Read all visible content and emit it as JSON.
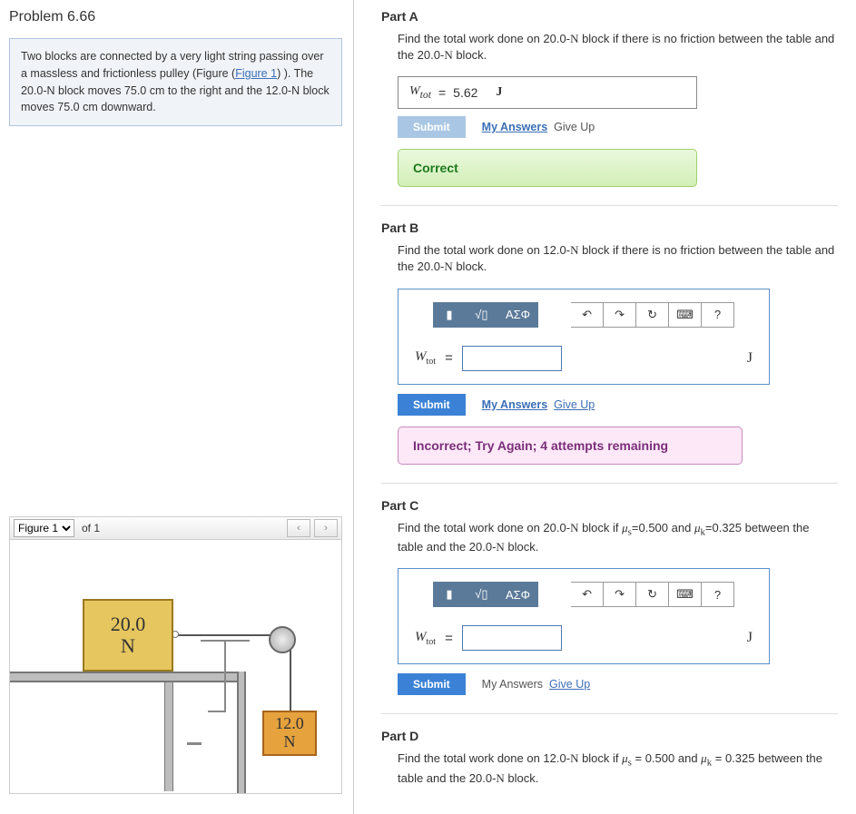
{
  "problem": {
    "title": "Problem 6.66",
    "description_pre": "Two blocks are connected by a very light string passing over a massless and frictionless pulley (Figure (",
    "figure_link": "Figure 1",
    "description_post": ") ). The 20.0-N block moves 75.0 cm to the right and the 12.0-N block moves 75.0 cm downward.",
    "block1_value": "20.0",
    "block1_unit": "N",
    "block2_value": "12.0",
    "block2_unit": "N"
  },
  "figure_bar": {
    "selected": "Figure 1",
    "of_label": "of 1",
    "prev": "‹",
    "next": "›"
  },
  "labels": {
    "submit": "Submit",
    "my_answers": "My Answers",
    "give_up": "Give Up",
    "w_var": "W",
    "w_sub": "tot",
    "equals": "=",
    "unit_J": "J"
  },
  "toolbar": {
    "tmpl": "▮",
    "frac": "√▯",
    "greek": "ΑΣΦ",
    "undo": "↶",
    "redo": "↷",
    "reset": "↻",
    "keyboard": "⌨",
    "help": "?"
  },
  "partA": {
    "label": "Part A",
    "prompt_1": "Find the total work done on 20.0-",
    "prompt_bold": "N",
    "prompt_2": " block if there is no friction between the table and the 20.0-",
    "prompt_bold2": "N",
    "prompt_3": " block.",
    "value": "5.62",
    "feedback": "Correct"
  },
  "partB": {
    "label": "Part B",
    "prompt_1": "Find the total work done on 12.0-",
    "prompt_bold": "N",
    "prompt_2": " block if there is no friction between the table and the 20.0-",
    "prompt_bold2": "N",
    "prompt_3": " block.",
    "value": "",
    "feedback": "Incorrect; Try Again; 4 attempts remaining"
  },
  "partC": {
    "label": "Part C",
    "prompt_1": "Find the total work done on 20.0-",
    "prompt_bold": "N",
    "prompt_2": " block if ",
    "mu_s": "μ",
    "mu_s_sub": "s",
    "mu_s_val": "=0.500",
    "and": " and ",
    "mu_k": "μ",
    "mu_k_sub": "k",
    "mu_k_val": "=0.325",
    "prompt_3": " between the table and the 20.0-",
    "prompt_bold2": "N",
    "prompt_4": " block.",
    "value": ""
  },
  "partD": {
    "label": "Part D",
    "prompt_1": "Find the total work done on 12.0-",
    "prompt_bold": "N",
    "prompt_2": " block if ",
    "mu_s": "μ",
    "mu_s_sub": "s",
    "mu_s_val": " = 0.500",
    "and": " and ",
    "mu_k": "μ",
    "mu_k_sub": "k",
    "mu_k_val": " = 0.325",
    "prompt_3": " between the table and the 20.0-",
    "prompt_bold2": "N",
    "prompt_4": " block."
  }
}
